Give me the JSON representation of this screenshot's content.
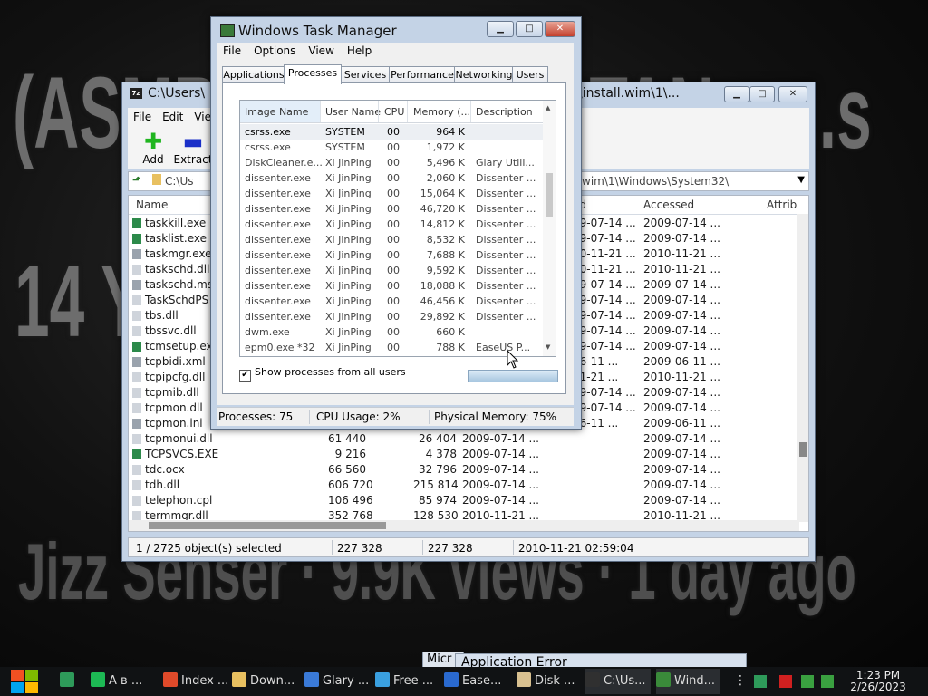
{
  "wallpaper": {
    "line1": "(ASMR) - Co... ...ASTAN... ...s",
    "line2": "14 Yea...                         ...rom...",
    "line3": "Jizz Senser · 9.9K views · 1 day ago"
  },
  "zip": {
    "title": "C:\\Users\\",
    "title_suffix": "rces\\install.wim\\1\\...",
    "app_icon_text": "7z",
    "menu": [
      "File",
      "Edit",
      "Vie"
    ],
    "toolbar": {
      "add": "Add",
      "extract": "Extract"
    },
    "address": "C:\\Us",
    "address_suffix": "wim\\1\\Windows\\System32\\",
    "columns": {
      "name": "Name",
      "modified": "ed",
      "accessed": "Accessed",
      "attrib": "Attrib"
    },
    "rows": [
      {
        "name": "taskkill.exe",
        "size": "",
        "packed": "",
        "modified": "09-07-14 ...",
        "accessed": "2009-07-14 ...",
        "icon": "exe"
      },
      {
        "name": "tasklist.exe",
        "size": "",
        "packed": "",
        "modified": "09-07-14 ...",
        "accessed": "2009-07-14 ...",
        "icon": "exe"
      },
      {
        "name": "taskmgr.exe",
        "size": "",
        "packed": "",
        "modified": "10-11-21 ...",
        "accessed": "2010-11-21 ...",
        "icon": "gear"
      },
      {
        "name": "taskschd.dll",
        "size": "",
        "packed": "",
        "modified": "10-11-21 ...",
        "accessed": "2010-11-21 ...",
        "icon": "dll"
      },
      {
        "name": "taskschd.ms",
        "size": "",
        "packed": "",
        "modified": "09-07-14 ...",
        "accessed": "2009-07-14 ...",
        "icon": "gear"
      },
      {
        "name": "TaskSchdPS",
        "size": "",
        "packed": "",
        "modified": "09-07-14 ...",
        "accessed": "2009-07-14 ...",
        "icon": "dll"
      },
      {
        "name": "tbs.dll",
        "size": "",
        "packed": "",
        "modified": "09-07-14 ...",
        "accessed": "2009-07-14 ...",
        "icon": "dll"
      },
      {
        "name": "tbssvc.dll",
        "size": "",
        "packed": "",
        "modified": "09-07-14 ...",
        "accessed": "2009-07-14 ...",
        "icon": "dll"
      },
      {
        "name": "tcmsetup.ex",
        "size": "",
        "packed": "",
        "modified": "09-07-14 ...",
        "accessed": "2009-07-14 ...",
        "icon": "exe"
      },
      {
        "name": "tcpbidi.xml",
        "size": "",
        "packed": "",
        "modified": "06-11 ...",
        "accessed": "2009-06-11 ...",
        "icon": "gear"
      },
      {
        "name": "tcpipcfg.dll",
        "size": "",
        "packed": "",
        "modified": "11-21 ...",
        "accessed": "2010-11-21 ...",
        "icon": "dll"
      },
      {
        "name": "tcpmib.dll",
        "size": "",
        "packed": "",
        "modified": "09-07-14 ...",
        "accessed": "2009-07-14 ...",
        "icon": "dll"
      },
      {
        "name": "tcpmon.dll",
        "size": "",
        "packed": "",
        "modified": "09-07-14 ...",
        "accessed": "2009-07-14 ...",
        "icon": "dll"
      },
      {
        "name": "tcpmon.ini",
        "size": "",
        "packed": "",
        "modified": "06-11 ...",
        "accessed": "2009-06-11 ...",
        "icon": "gear"
      },
      {
        "name": "tcpmonui.dll",
        "size": "61 440",
        "packed": "26 404",
        "modified": "2009-07-14 ...",
        "accessed": "2009-07-14 ...",
        "icon": "dll"
      },
      {
        "name": "TCPSVCS.EXE",
        "size": "9 216",
        "packed": "4 378",
        "modified": "2009-07-14 ...",
        "accessed": "2009-07-14 ...",
        "icon": "exe"
      },
      {
        "name": "tdc.ocx",
        "size": "66 560",
        "packed": "32 796",
        "modified": "2009-07-14 ...",
        "accessed": "2009-07-14 ...",
        "icon": "dll"
      },
      {
        "name": "tdh.dll",
        "size": "606 720",
        "packed": "215 814",
        "modified": "2009-07-14 ...",
        "accessed": "2009-07-14 ...",
        "icon": "dll"
      },
      {
        "name": "telephon.cpl",
        "size": "106 496",
        "packed": "85 974",
        "modified": "2009-07-14 ...",
        "accessed": "2009-07-14 ...",
        "icon": "dll"
      },
      {
        "name": "termmgr.dll",
        "size": "352 768",
        "packed": "128 530",
        "modified": "2010-11-21 ...",
        "accessed": "2010-11-21 ...",
        "icon": "dll"
      }
    ],
    "status": {
      "selected": "1 / 2725 object(s) selected",
      "size": "227 328",
      "packed": "227 328",
      "date": "2010-11-21 02:59:04"
    }
  },
  "taskmgr": {
    "title": "Windows Task Manager",
    "menu": [
      "File",
      "Options",
      "View",
      "Help"
    ],
    "tabs": [
      "Applications",
      "Processes",
      "Services",
      "Performance",
      "Networking",
      "Users"
    ],
    "active_tab": "Processes",
    "columns": {
      "image": "Image Name",
      "user": "User Name",
      "cpu": "CPU",
      "memory": "Memory (...",
      "desc": "Description"
    },
    "processes": [
      {
        "image": "csrss.exe",
        "user": "SYSTEM",
        "cpu": "00",
        "memory": "964 K",
        "desc": "",
        "selected": true
      },
      {
        "image": "csrss.exe",
        "user": "SYSTEM",
        "cpu": "00",
        "memory": "1,972 K",
        "desc": ""
      },
      {
        "image": "DiskCleaner.e...",
        "user": "Xi JinPing",
        "cpu": "00",
        "memory": "5,496 K",
        "desc": "Glary Utili..."
      },
      {
        "image": "dissenter.exe",
        "user": "Xi JinPing",
        "cpu": "00",
        "memory": "2,060 K",
        "desc": "Dissenter ..."
      },
      {
        "image": "dissenter.exe",
        "user": "Xi JinPing",
        "cpu": "00",
        "memory": "15,064 K",
        "desc": "Dissenter ..."
      },
      {
        "image": "dissenter.exe",
        "user": "Xi JinPing",
        "cpu": "00",
        "memory": "46,720 K",
        "desc": "Dissenter ..."
      },
      {
        "image": "dissenter.exe",
        "user": "Xi JinPing",
        "cpu": "00",
        "memory": "14,812 K",
        "desc": "Dissenter ..."
      },
      {
        "image": "dissenter.exe",
        "user": "Xi JinPing",
        "cpu": "00",
        "memory": "8,532 K",
        "desc": "Dissenter ..."
      },
      {
        "image": "dissenter.exe",
        "user": "Xi JinPing",
        "cpu": "00",
        "memory": "7,688 K",
        "desc": "Dissenter ..."
      },
      {
        "image": "dissenter.exe",
        "user": "Xi JinPing",
        "cpu": "00",
        "memory": "9,592 K",
        "desc": "Dissenter ..."
      },
      {
        "image": "dissenter.exe",
        "user": "Xi JinPing",
        "cpu": "00",
        "memory": "18,088 K",
        "desc": "Dissenter ..."
      },
      {
        "image": "dissenter.exe",
        "user": "Xi JinPing",
        "cpu": "00",
        "memory": "46,456 K",
        "desc": "Dissenter ..."
      },
      {
        "image": "dissenter.exe",
        "user": "Xi JinPing",
        "cpu": "00",
        "memory": "29,892 K",
        "desc": "Dissenter ..."
      },
      {
        "image": "dwm.exe",
        "user": "Xi JinPing",
        "cpu": "00",
        "memory": "660 K",
        "desc": ""
      },
      {
        "image": "epm0.exe *32",
        "user": "Xi JinPing",
        "cpu": "00",
        "memory": "788 K",
        "desc": "EaseUS P..."
      }
    ],
    "show_all_label": "Show processes from all users",
    "show_all_checked": true,
    "status": {
      "processes": "Processes: 75",
      "cpu": "CPU Usage: 2%",
      "memory": "Physical Memory: 75%"
    }
  },
  "popups": {
    "micr": "Micr",
    "error": "Application Error"
  },
  "taskbar": {
    "items": [
      {
        "label": "",
        "color": "#2e9a5a"
      },
      {
        "label": "A в ...",
        "color": "#1db954"
      },
      {
        "label": "Index ...",
        "color": "#e04a2a"
      },
      {
        "label": "Down...",
        "color": "#e8c060"
      },
      {
        "label": "Glary ...",
        "color": "#3a7ad8"
      },
      {
        "label": "Free ...",
        "color": "#3aa0e0"
      },
      {
        "label": "Ease...",
        "color": "#2a6ad0"
      },
      {
        "label": "Disk ...",
        "color": "#d8c090"
      },
      {
        "label": "C:\\Us...",
        "color": "#303030"
      },
      {
        "label": "Wind...",
        "color": "#3a8a3a"
      }
    ],
    "time": "1:23 PM",
    "date": "2/26/2023"
  }
}
